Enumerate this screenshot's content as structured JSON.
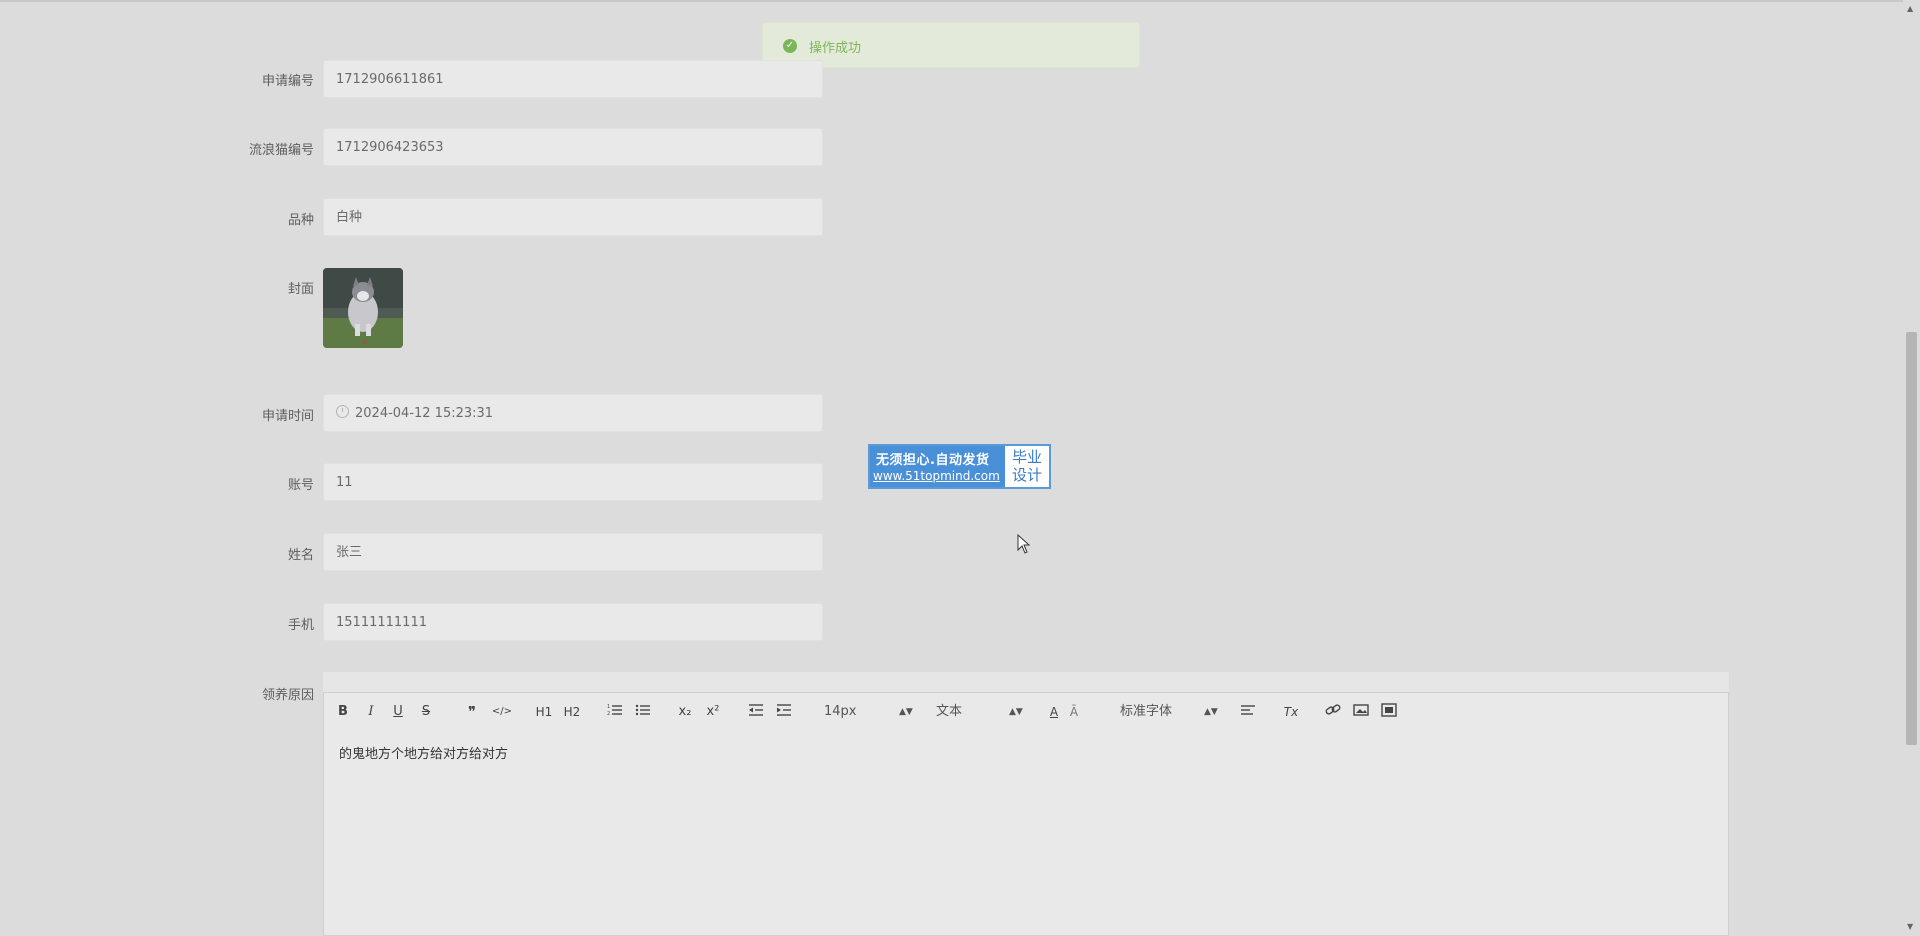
{
  "toast": {
    "message": "操作成功",
    "icon": "check-circle-icon",
    "color": "#7cb65a"
  },
  "form": {
    "apply_no": {
      "label": "申请编号",
      "value": "1712906611861"
    },
    "cat_no": {
      "label": "流浪猫编号",
      "value": "1712906423653"
    },
    "breed": {
      "label": "品种",
      "value": "白种"
    },
    "cover": {
      "label": "封面"
    },
    "apply_time": {
      "label": "申请时间",
      "value": "2024-04-12 15:23:31"
    },
    "account": {
      "label": "账号",
      "value": "11"
    },
    "name": {
      "label": "姓名",
      "value": "张三"
    },
    "phone": {
      "label": "手机",
      "value": "15111111111"
    },
    "reason": {
      "label": "领养原因",
      "value": "的鬼地方个地方给对方给对方"
    }
  },
  "editor_toolbar": {
    "bold": "B",
    "italic": "I",
    "underline": "U",
    "strike": "S",
    "quote": "❞",
    "code": "</>",
    "h1": "H1",
    "h2": "H2",
    "subscript": "x₂",
    "superscript": "x²",
    "font_size": "14px",
    "header_select": "文本",
    "font_family": "标准字体",
    "clear_format": "Tx"
  },
  "ad": {
    "line1": "无须担心.自动发货",
    "line2": "www.51topmind.com",
    "right": "毕业\n设计"
  }
}
